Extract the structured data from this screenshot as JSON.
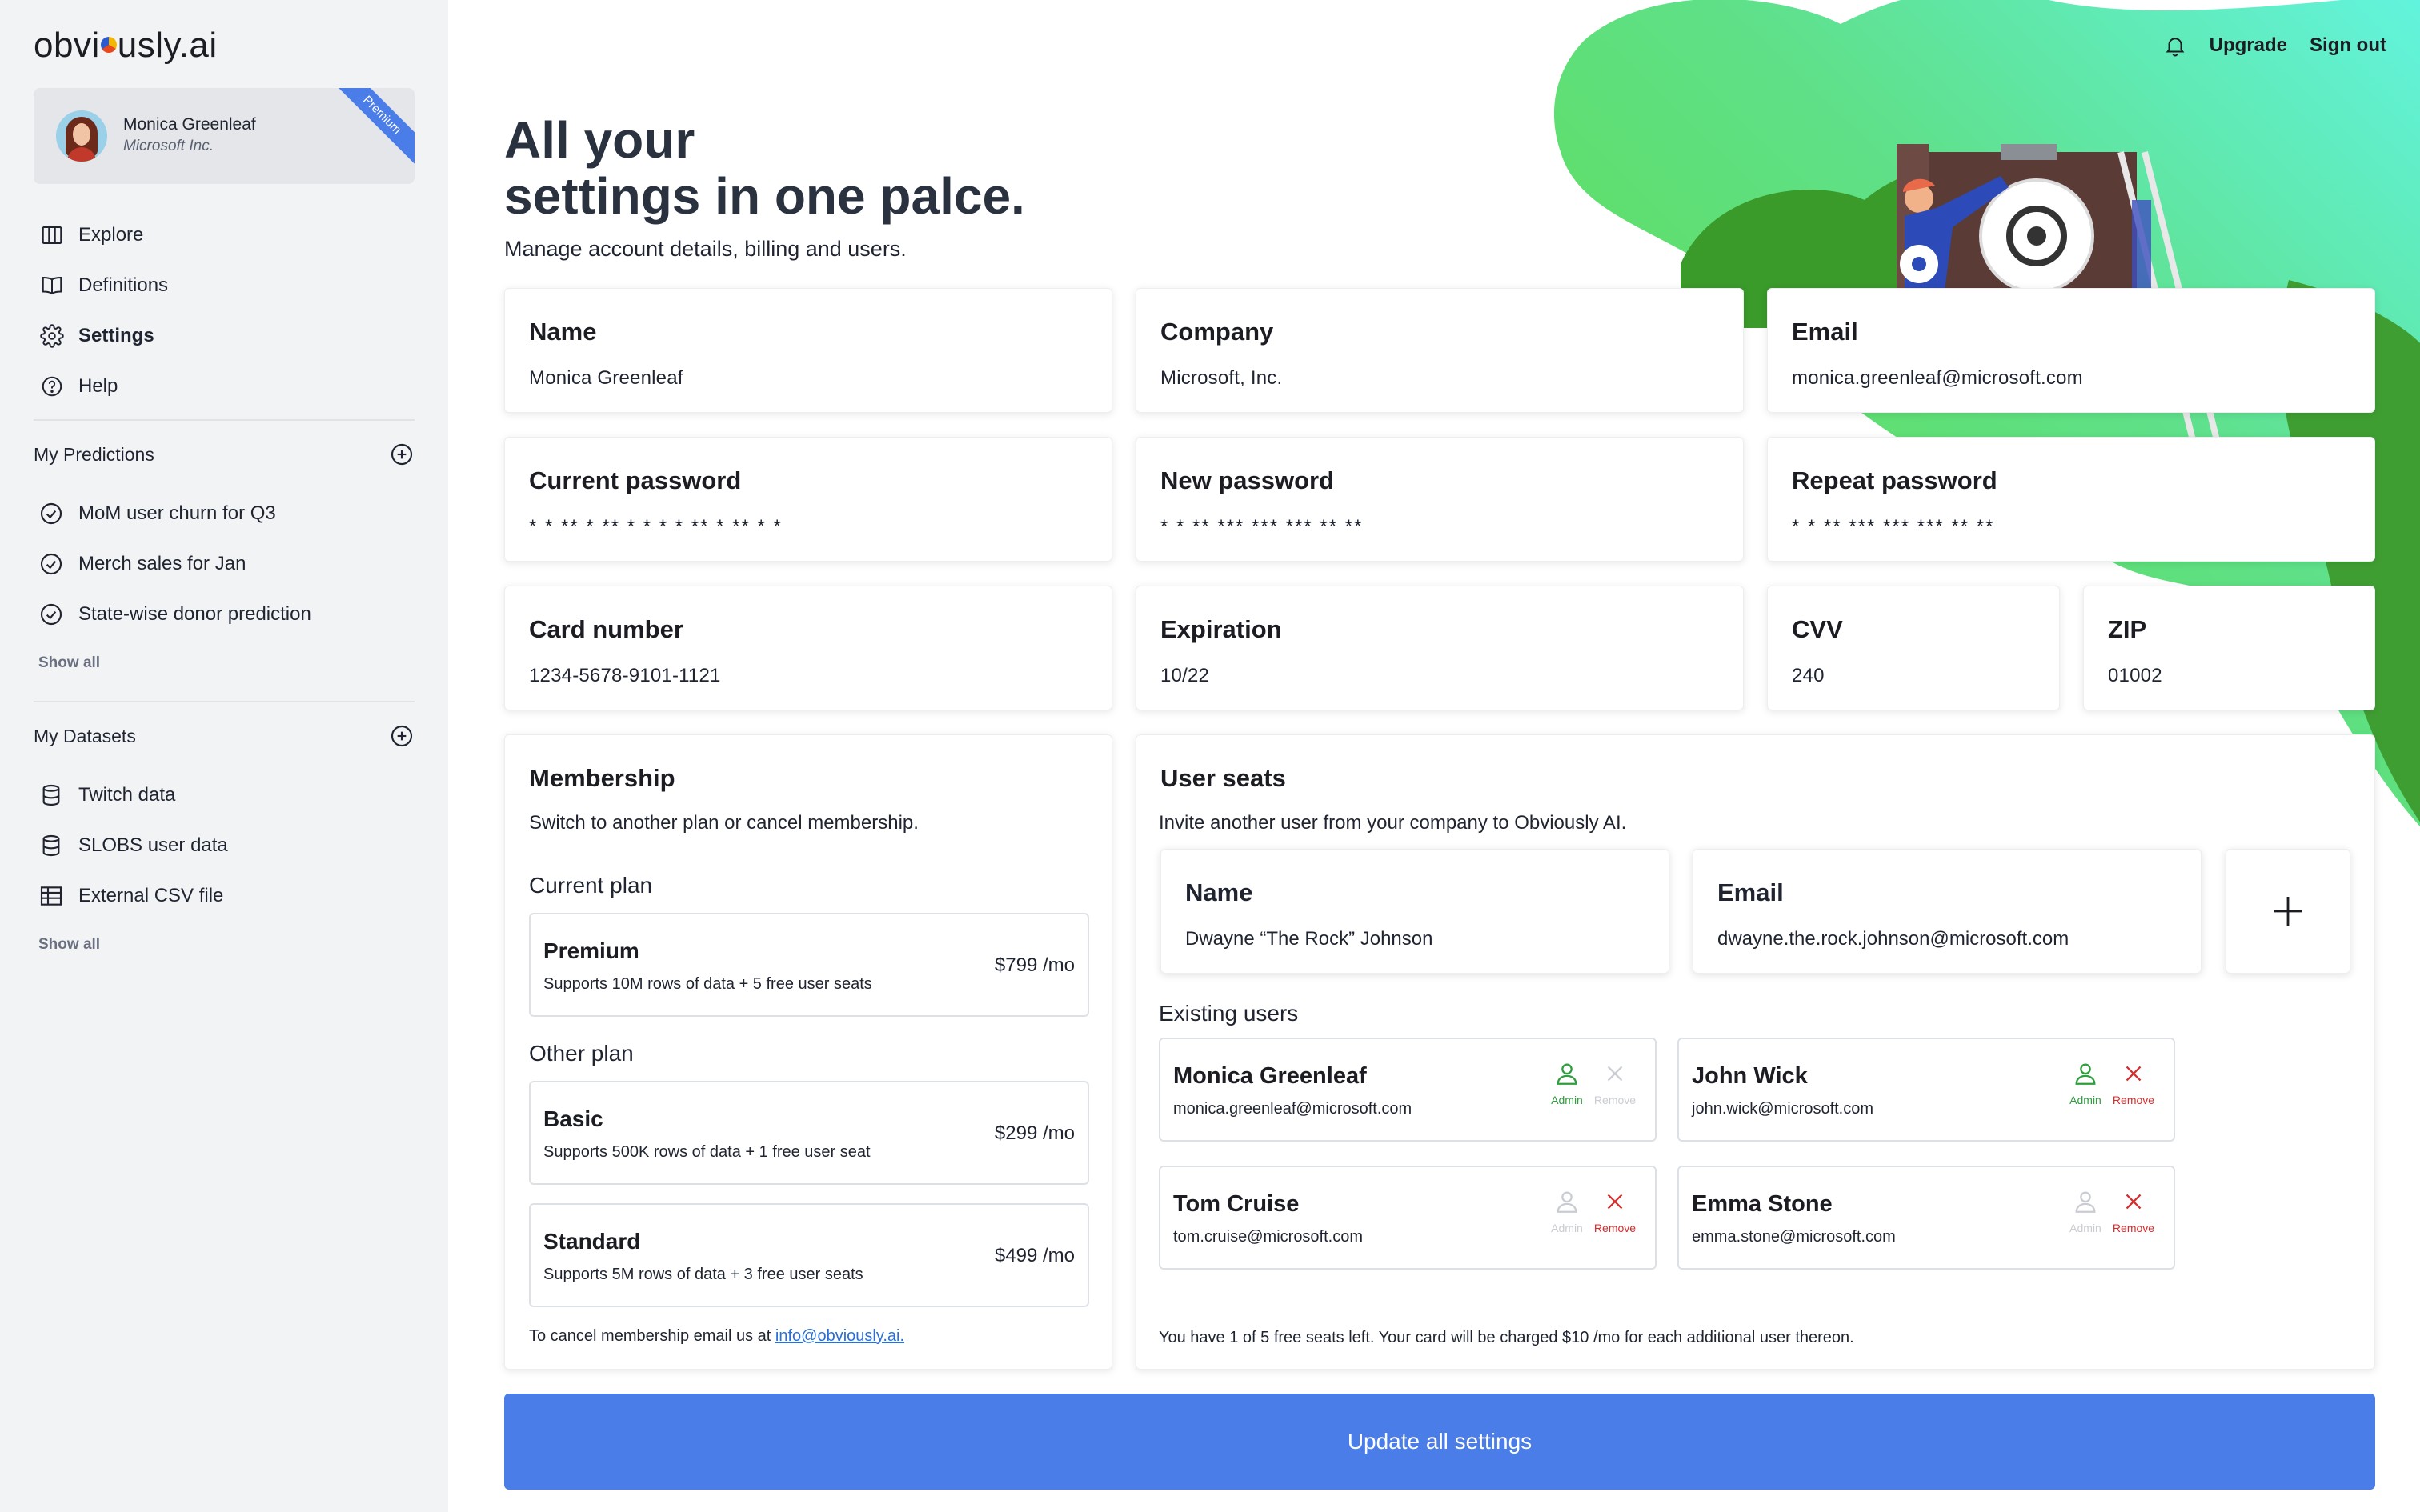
{
  "app": {
    "logo_text_1": "obvi",
    "logo_text_2": "usly.ai"
  },
  "profile": {
    "name": "Monica Greenleaf",
    "company": "Microsoft Inc.",
    "badge": "Premium"
  },
  "nav": [
    {
      "label": "Explore",
      "icon": "columns-icon"
    },
    {
      "label": "Definitions",
      "icon": "book-icon"
    },
    {
      "label": "Settings",
      "icon": "gear-icon",
      "active": true
    },
    {
      "label": "Help",
      "icon": "help-icon"
    }
  ],
  "predictions": {
    "title": "My Predictions",
    "items": [
      "MoM user churn for Q3",
      "Merch sales for Jan",
      "State-wise donor prediction"
    ],
    "show_all": "Show all"
  },
  "datasets": {
    "title": "My Datasets",
    "items": [
      "Twitch data",
      "SLOBS user data",
      "External CSV file"
    ],
    "show_all": "Show all"
  },
  "topnav": {
    "upgrade": "Upgrade",
    "signout": "Sign out"
  },
  "hero": {
    "title_line1": "All your",
    "title_line2": "settings in one palce.",
    "subtitle": "Manage account details, billing and users."
  },
  "account": {
    "name_label": "Name",
    "name_value": "Monica Greenleaf",
    "company_label": "Company",
    "company_value": "Microsoft, Inc.",
    "email_label": "Email",
    "email_value": "monica.greenleaf@microsoft.com"
  },
  "passwords": {
    "current_label": "Current password",
    "current_value": "* * ** * ** * * * * ** * ** * *",
    "new_label": "New password",
    "new_value": "* * ** *** *** *** ** **",
    "repeat_label": "Repeat password",
    "repeat_value": "* * ** *** *** *** ** **"
  },
  "billing": {
    "card_label": "Card number",
    "card_value": "1234-5678-9101-1121",
    "exp_label": "Expiration",
    "exp_value": "10/22",
    "cvv_label": "CVV",
    "cvv_value": "240",
    "zip_label": "ZIP",
    "zip_value": "01002"
  },
  "membership": {
    "title": "Membership",
    "subtitle": "Switch to another plan or cancel membership.",
    "current_heading": "Current plan",
    "other_heading": "Other plan",
    "current": {
      "name": "Premium",
      "desc": "Supports 10M rows of data + 5 free user seats",
      "price": "$799 /mo"
    },
    "others": [
      {
        "name": "Basic",
        "desc": "Supports 500K rows of data + 1 free user seat",
        "price": "$299 /mo"
      },
      {
        "name": "Standard",
        "desc": "Supports 5M rows of data + 3 free user seats",
        "price": "$499 /mo"
      }
    ],
    "cancel_text": "To cancel membership email us at ",
    "cancel_link": "info@obviously.ai."
  },
  "seats": {
    "title": "User seats",
    "subtitle": "Invite another user from your company to Obviously AI.",
    "invite": {
      "name_label": "Name",
      "name_value": "Dwayne “The Rock” Johnson",
      "email_label": "Email",
      "email_value": "dwayne.the.rock.johnson@microsoft.com"
    },
    "existing_label": "Existing users",
    "users": [
      {
        "name": "Monica Greenleaf",
        "email": "monica.greenleaf@microsoft.com",
        "admin_label": "Admin",
        "remove_label": "Remove"
      },
      {
        "name": "John Wick",
        "email": "john.wick@microsoft.com",
        "admin_label": "Admin",
        "remove_label": "Remove"
      },
      {
        "name": "Tom Cruise",
        "email": "tom.cruise@microsoft.com",
        "admin_label": "Admin",
        "remove_label": "Remove"
      },
      {
        "name": "Emma Stone",
        "email": "emma.stone@microsoft.com",
        "admin_label": "Admin",
        "remove_label": "Remove"
      }
    ],
    "note": "You have 1 of 5 free seats left. Your card will be charged $10 /mo for each additional user thereon."
  },
  "update_button": "Update all settings",
  "colors": {
    "accent": "#4a7de8",
    "admin_active": "#2e9e3e",
    "remove": "#d92b2b",
    "inactive": "#c9ccd2"
  }
}
